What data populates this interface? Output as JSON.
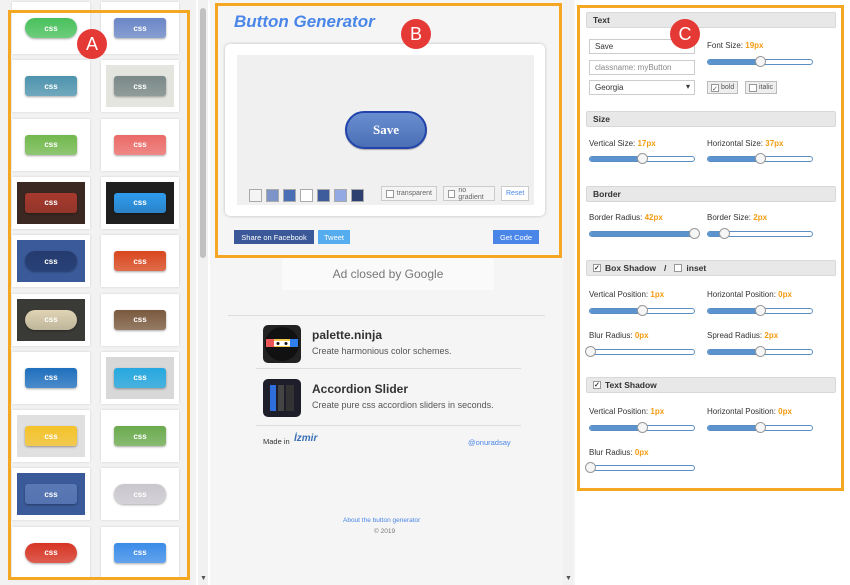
{
  "annotations": {
    "a": "A",
    "b": "B",
    "c": "C"
  },
  "gallery": {
    "tiles": [
      {
        "label": "css",
        "bg": "#ffffff",
        "color": "#49c05b",
        "round": true
      },
      {
        "label": "css",
        "bg": "#ffffff",
        "color": "#6a86c6",
        "round": false
      },
      {
        "label": "css",
        "bg": "#ffffff",
        "color": "#4d93ad",
        "round": false
      },
      {
        "label": "css",
        "bg": "#e5e5e0",
        "color": "#7a8a88",
        "round": false
      },
      {
        "label": "css",
        "bg": "#ffffff",
        "color": "#72b84e",
        "round": false
      },
      {
        "label": "css",
        "bg": "#ffffff",
        "color": "#ea6a67",
        "round": false
      },
      {
        "label": "css",
        "bg": "#3b2822",
        "color": "#a8392d",
        "round": false
      },
      {
        "label": "css",
        "bg": "#1f1f1f",
        "color": "#2e9cf0",
        "round": false
      },
      {
        "label": "css",
        "bg": "#3a5a9a",
        "color": "#243b6e",
        "round": true
      },
      {
        "label": "css",
        "bg": "#ffffff",
        "color": "#d8471e",
        "round": false
      },
      {
        "label": "css",
        "bg": "#3a3a36",
        "color": "#e0d4b4",
        "round": true
      },
      {
        "label": "css",
        "bg": "#ffffff",
        "color": "#7a5a3e",
        "round": false
      },
      {
        "label": "css",
        "bg": "#ffffff",
        "color": "#1f6fbd",
        "round": false
      },
      {
        "label": "css",
        "bg": "#d8d8d8",
        "color": "#26a8e0",
        "round": false
      },
      {
        "label": "css",
        "bg": "#e0e0e0",
        "color": "#f5c32a",
        "round": false
      },
      {
        "label": "css",
        "bg": "#ffffff",
        "color": "#6aaa4e",
        "round": false
      },
      {
        "label": "css",
        "bg": "#3a5a9a",
        "color": "#5a79b5",
        "round": false
      },
      {
        "label": "css",
        "bg": "#ffffff",
        "color": "#c9c6cd",
        "round": true
      },
      {
        "label": "css",
        "bg": "#ffffff",
        "color": "#d63524",
        "round": true
      },
      {
        "label": "css",
        "bg": "#ffffff",
        "color": "#3b8ce8",
        "round": false
      }
    ]
  },
  "middle": {
    "title": "Button Generator",
    "preview_button": "Save",
    "swatches": [
      "#f4f4f4",
      "#7d94c8",
      "#4a6fb5",
      "#ffffff",
      "#3e5c9c",
      "#93a9e4",
      "#2c3f6e"
    ],
    "transparent": "transparent",
    "no_gradient": "no gradient",
    "reset": "Reset",
    "share_fb": "Share on Facebook",
    "tweet": "Tweet",
    "get_code": "Get Code",
    "ad": "Ad closed by Google",
    "promos": [
      {
        "title": "palette.ninja",
        "desc": "Create harmonious color schemes."
      },
      {
        "title": "Accordion Slider",
        "desc": "Create pure css accordion sliders in seconds."
      }
    ],
    "made_in": "Made in",
    "made_in_logo": "İzmir",
    "handle": "@onuradsay",
    "about": "About the button generator",
    "copyright": "© 2019"
  },
  "right": {
    "text_section": "Text",
    "text_value": "Save",
    "classname_placeholder": "classname: myButton",
    "font": "Georgia",
    "font_size_label": "Font Size:",
    "font_size": "19px",
    "bold": "bold",
    "italic": "italic",
    "size_section": "Size",
    "vsize_label": "Vertical Size:",
    "vsize": "17px",
    "hsize_label": "Horizontal Size:",
    "hsize": "37px",
    "border_section": "Border",
    "bradius_label": "Border Radius:",
    "bradius": "42px",
    "bsize_label": "Border Size:",
    "bsize": "2px",
    "boxshadow_section": "Box Shadow",
    "slash": "/",
    "inset": "inset",
    "bs_vpos_label": "Vertical Position:",
    "bs_vpos": "1px",
    "bs_hpos_label": "Horizontal Position:",
    "bs_hpos": "0px",
    "bs_blur_label": "Blur Radius:",
    "bs_blur": "0px",
    "bs_spread_label": "Spread Radius:",
    "bs_spread": "2px",
    "textshadow_section": "Text Shadow",
    "ts_vpos_label": "Vertical Position:",
    "ts_vpos": "1px",
    "ts_hpos_label": "Horizontal Position:",
    "ts_hpos": "0px",
    "ts_blur_label": "Blur Radius:",
    "ts_blur": "0px",
    "sliders": {
      "font": 0.5,
      "vsize": 0.5,
      "hsize": 0.5,
      "bradius": 1.0,
      "bsize": 0.15,
      "bs_v": 0.5,
      "bs_h": 0.5,
      "bs_blur": 0.0,
      "bs_spread": 0.5,
      "ts_v": 0.5,
      "ts_h": 0.5,
      "ts_blur": 0.0
    }
  }
}
